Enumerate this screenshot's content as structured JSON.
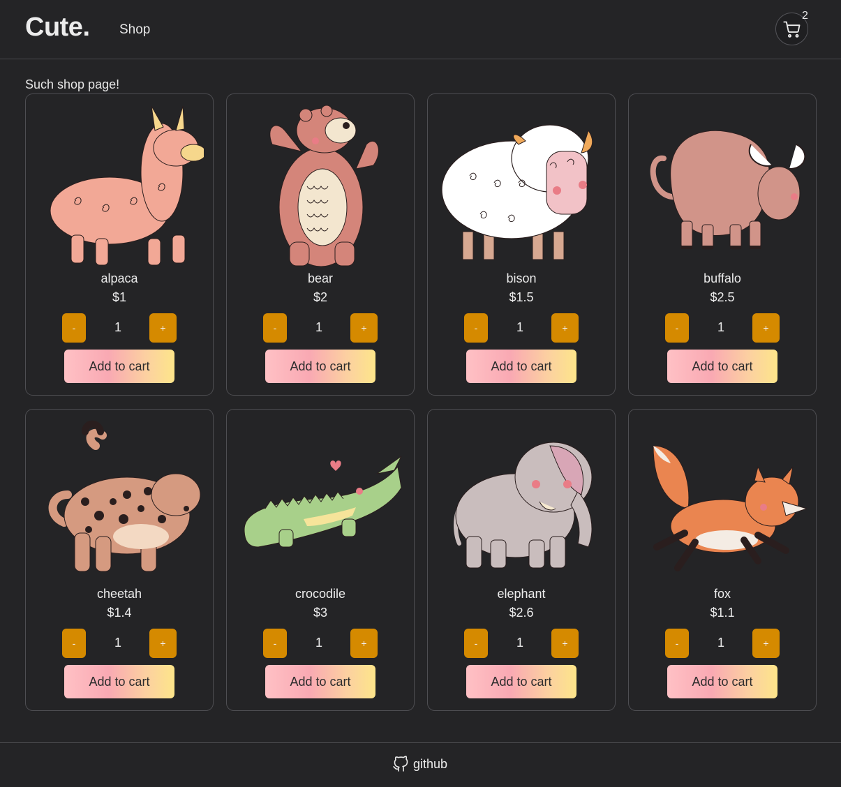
{
  "header": {
    "logo": "Cute.",
    "nav_shop": "Shop",
    "cart_count": "2"
  },
  "subtitle": "Such shop page!",
  "products": [
    {
      "name": "alpaca",
      "price": "$1",
      "qty": "1",
      "minus": "-",
      "plus": "+",
      "add_label": "Add to cart",
      "color": "#f2a896"
    },
    {
      "name": "bear",
      "price": "$2",
      "qty": "1",
      "minus": "-",
      "plus": "+",
      "add_label": "Add to cart",
      "color": "#d4857a"
    },
    {
      "name": "bison",
      "price": "$1.5",
      "qty": "1",
      "minus": "-",
      "plus": "+",
      "add_label": "Add to cart",
      "color": "#ffffff"
    },
    {
      "name": "buffalo",
      "price": "$2.5",
      "qty": "1",
      "minus": "-",
      "plus": "+",
      "add_label": "Add to cart",
      "color": "#d19489"
    },
    {
      "name": "cheetah",
      "price": "$1.4",
      "qty": "1",
      "minus": "-",
      "plus": "+",
      "add_label": "Add to cart",
      "color": "#d59a80"
    },
    {
      "name": "crocodile",
      "price": "$3",
      "qty": "1",
      "minus": "-",
      "plus": "+",
      "add_label": "Add to cart",
      "color": "#a8d08a"
    },
    {
      "name": "elephant",
      "price": "$2.6",
      "qty": "1",
      "minus": "-",
      "plus": "+",
      "add_label": "Add to cart",
      "color": "#c9bdbd"
    },
    {
      "name": "fox",
      "price": "$1.1",
      "qty": "1",
      "minus": "-",
      "plus": "+",
      "add_label": "Add to cart",
      "color": "#ea8550"
    }
  ],
  "footer": {
    "github_label": "github"
  },
  "colors": {
    "accent": "#d58a00",
    "background": "#242426"
  },
  "icons": {
    "cart": "cart-icon",
    "github": "github-icon"
  }
}
